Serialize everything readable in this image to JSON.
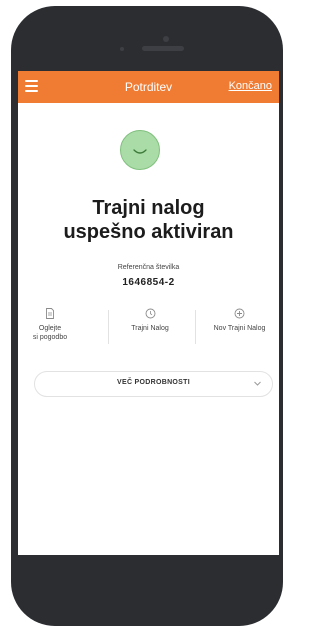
{
  "header": {
    "title": "Potrditev",
    "done_label": "Končano"
  },
  "confirmation": {
    "headline_line1": "Trajni nalog",
    "headline_line2": "uspešno aktiviran",
    "reference_label": "Referenčna številka",
    "reference_number": "1646854-2"
  },
  "actions": [
    {
      "label_line1": "Oglejte",
      "label_line2": "si pogodbo",
      "icon": "document-icon"
    },
    {
      "label_line1": "Trajni Nalog",
      "label_line2": "",
      "icon": "clock-icon"
    },
    {
      "label_line1": "Nov Trajni Nalog",
      "label_line2": "",
      "icon": "plus-circle-icon"
    }
  ],
  "details_button": {
    "label": "VEČ PODROBNOSTI",
    "icon": "chevron-down-icon"
  },
  "colors": {
    "accent": "#f07c33",
    "success_fill": "#a9dca6",
    "phone_body": "#2b2d31"
  }
}
